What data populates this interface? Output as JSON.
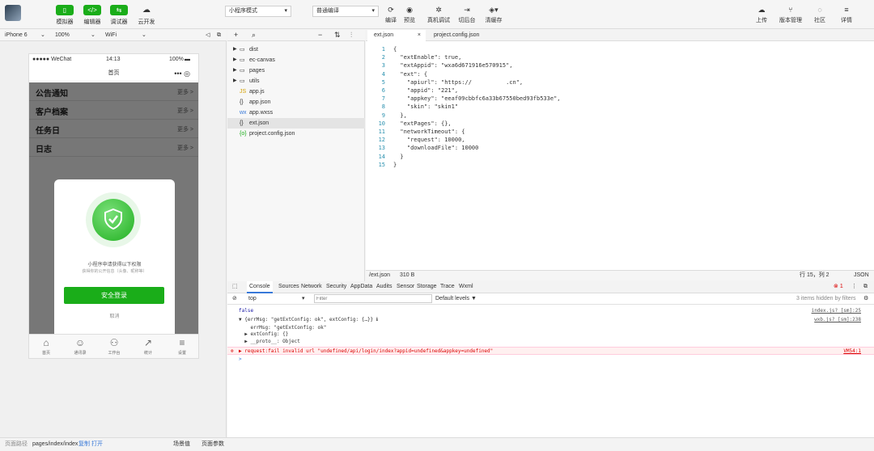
{
  "toolbar": {
    "simulator": "模拟器",
    "editor": "编辑器",
    "debugger": "调试器",
    "cloud": "云开发",
    "mode": "小程序模式",
    "compile_mode": "普通编译",
    "compile": "编译",
    "preview": "预览",
    "real_debug": "真机调试",
    "background": "切后台",
    "clear_cache": "清缓存",
    "upload": "上传",
    "version": "版本管理",
    "community": "社区",
    "details": "详情"
  },
  "simbar": {
    "device": "iPhone 6",
    "zoom": "100%",
    "network": "WiFi"
  },
  "phone": {
    "carrier": "●●●●● WeChat",
    "time": "14:13",
    "battery": "100%",
    "nav_title": "首页",
    "rows": [
      {
        "title": "公告通知",
        "more": "更多 >"
      },
      {
        "title": "客户档案",
        "more": "更多 >"
      },
      {
        "title": "任务日",
        "more": "更多 >"
      },
      {
        "title": "日志",
        "more": "更多 >"
      }
    ],
    "modal": {
      "line1": "小程序申请获得以下权限",
      "line2": "获得你的公开信息（头像、昵称等）",
      "login": "安全登录",
      "cancel": "取消"
    },
    "tabs": [
      {
        "icon": "⌂",
        "label": "首页"
      },
      {
        "icon": "☺",
        "label": "通讯录"
      },
      {
        "icon": "⚇",
        "label": "工作台"
      },
      {
        "icon": "↗",
        "label": "统计"
      },
      {
        "icon": "≡",
        "label": "设置"
      }
    ]
  },
  "explorer": {
    "files": [
      {
        "arrow": "▶",
        "icon": "▭",
        "name": "dist",
        "sel": false
      },
      {
        "arrow": "▶",
        "icon": "▭",
        "name": "ec-canvas",
        "sel": false
      },
      {
        "arrow": "▶",
        "icon": "▭",
        "name": "pages",
        "sel": false
      },
      {
        "arrow": "▶",
        "icon": "▭",
        "name": "utils",
        "sel": false
      },
      {
        "arrow": "",
        "icon": "JS",
        "name": "app.js",
        "sel": false
      },
      {
        "arrow": "",
        "icon": "{}",
        "name": "app.json",
        "sel": false
      },
      {
        "arrow": "",
        "icon": "wx",
        "name": "app.wxss",
        "sel": false
      },
      {
        "arrow": "",
        "icon": "{}",
        "name": "ext.json",
        "sel": true
      },
      {
        "arrow": "",
        "icon": "{o}",
        "name": "project.config.json",
        "sel": false
      }
    ]
  },
  "editor": {
    "tab_active": "ext.json",
    "tab_other": "project.config.json",
    "lines": [
      "{",
      "  \"extEnable\": true,",
      "  \"extAppid\": \"wxa6d671916e570915\",",
      "  \"ext\": {",
      "    \"apiurl\": \"https://          .cn\",",
      "    \"appid\": \"221\",",
      "    \"appkey\": \"eeaf09cbbfc6a33b67550bed93fb533e\",",
      "    \"skin\": \"skin1\"",
      "  },",
      "  \"extPages\": {},",
      "  \"networkTimeout\": {",
      "    \"request\": 10000,",
      "    \"downloadFile\": 10000",
      "  }",
      "}"
    ],
    "status_path": "/ext.json",
    "status_size": "310 B",
    "status_pos": "行 15，列 2",
    "status_lang": "JSON"
  },
  "devtools": {
    "tabs": [
      "Console",
      "Sources",
      "Network",
      "Security",
      "AppData",
      "Audits",
      "Sensor",
      "Storage",
      "Trace",
      "Wxml"
    ],
    "context": "top",
    "filter_placeholder": "Filter",
    "levels": "Default levels ▼",
    "hidden": "3 items hidden by filters",
    "error_count": "1",
    "lines": [
      {
        "text": "false",
        "src": "index.js? [sm]:25",
        "err": false
      },
      {
        "text": "▼ {errMsg: \"getExtConfig: ok\", extConfig: {…}} ℹ",
        "src": "wxb.js? [sm]:238",
        "err": false
      },
      {
        "text": "    errMsg: \"getExtConfig: ok\"",
        "src": "",
        "err": false
      },
      {
        "text": "  ▶ extConfig: {}",
        "src": "",
        "err": false
      },
      {
        "text": "  ▶ __proto__: Object",
        "src": "",
        "err": false
      },
      {
        "text": "▶ request:fail invalid url \"undefined/api/login/index?appid=undefined&appkey=undefined\"",
        "src": "VM54:1",
        "err": true
      },
      {
        "text": ">",
        "src": "",
        "err": false
      }
    ]
  },
  "bottom": {
    "label": "页面路径",
    "path": "pages/index/index",
    "copy": "复制",
    "open": "打开",
    "scene": "场景值",
    "params": "页面参数"
  }
}
